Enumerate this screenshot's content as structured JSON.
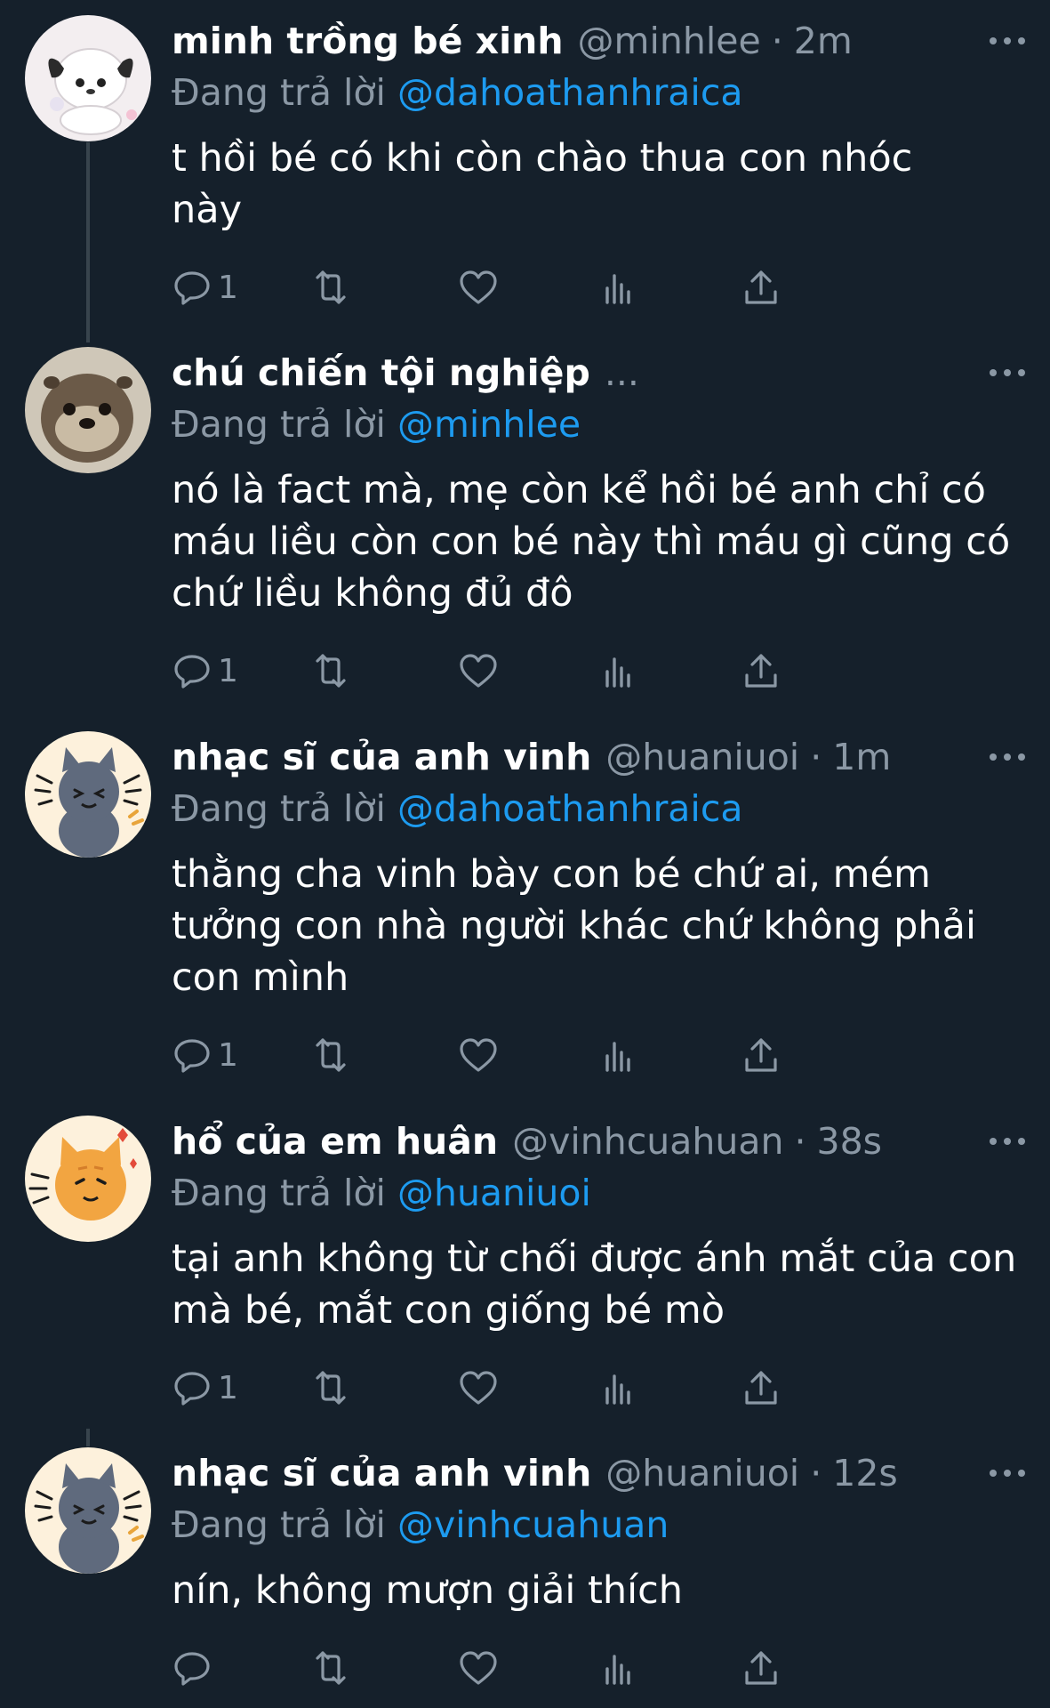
{
  "colors": {
    "background": "#15202b",
    "text": "#ffffff",
    "muted": "#8b98a5",
    "mention": "#1d9bf0",
    "thread_line": "#38444d"
  },
  "replying_prefix": "Đang trả lời",
  "tweets": [
    {
      "display_name": "minh trồng bé xinh",
      "handle": "@minhlee",
      "time": "2m",
      "replying_to": "@dahoathanhraica",
      "text": "t hồi bé có khi còn chào thua con nhóc này",
      "reply_count": "1",
      "avatar_icon": "dog-avatar-icon"
    },
    {
      "display_name": "chú chiến tội nghiệp",
      "handle": "",
      "time": "",
      "truncated": "...",
      "replying_to": "@minhlee",
      "text": "nó là fact mà, mẹ còn kể hồi bé anh chỉ có máu liều còn con bé này thì máu gì cũng có chứ liều không đủ đô",
      "reply_count": "1",
      "avatar_icon": "otter-avatar-icon"
    },
    {
      "display_name": "nhạc sĩ của anh vinh",
      "handle": "@huaniuoi",
      "time": "1m",
      "replying_to": "@dahoathanhraica",
      "text": "thằng cha vinh bày con bé chứ ai, mém tưởng con nhà người khác chứ không phải con mình",
      "reply_count": "1",
      "avatar_icon": "gray-cat-avatar-icon"
    },
    {
      "display_name": "hổ của em huân",
      "handle": "@vinhcuahuan",
      "time": "38s",
      "replying_to": "@huaniuoi",
      "text": "tại anh không từ chối được ánh mắt của con mà bé, mắt con giống bé mò",
      "reply_count": "1",
      "avatar_icon": "orange-cat-avatar-icon"
    },
    {
      "display_name": "nhạc sĩ của anh vinh",
      "handle": "@huaniuoi",
      "time": "12s",
      "replying_to": "@vinhcuahuan",
      "text": "nín, không mượn giải thích",
      "reply_count": "",
      "avatar_icon": "gray-cat-avatar-icon"
    }
  ]
}
